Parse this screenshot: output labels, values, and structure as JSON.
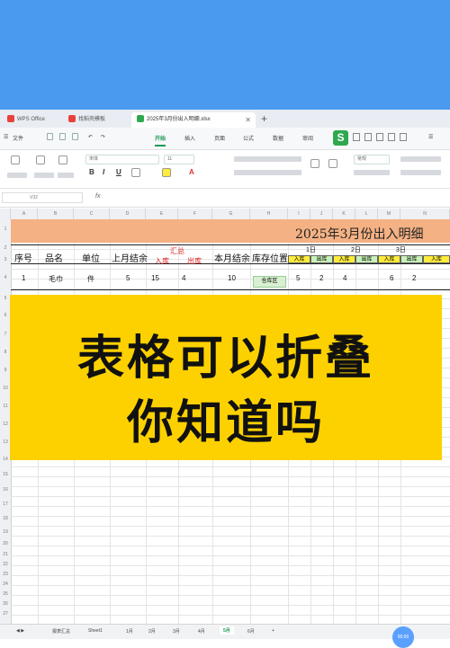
{
  "browser_tabs": [
    {
      "label": "WPS Office",
      "color": "#e8423b"
    },
    {
      "label": "找稻壳模板",
      "color": "#e8423b"
    },
    {
      "label": "2025年3月份出入明细.xlsx",
      "color": "#2fa84f"
    }
  ],
  "menu": {
    "file": "文件",
    "items": [
      "开始",
      "插入",
      "页面",
      "公式",
      "数据",
      "审阅"
    ],
    "selected": "开始"
  },
  "ribbon": {
    "font_name": "宋体",
    "font_size": "11",
    "format_buttons": [
      "B",
      "I",
      "U",
      "A"
    ],
    "number_format": "常规"
  },
  "formula_bar": {
    "cell_ref": "V32",
    "fx": "fx"
  },
  "columns": [
    "A",
    "B",
    "C",
    "D",
    "E",
    "F",
    "G",
    "H",
    "I",
    "J",
    "K",
    "L",
    "M",
    "N"
  ],
  "rows": [
    "1",
    "2",
    "3",
    "4",
    "5",
    "6",
    "7",
    "8",
    "9",
    "10",
    "11",
    "12",
    "13",
    "14",
    "15",
    "16",
    "17",
    "18",
    "19",
    "20",
    "21",
    "22",
    "23",
    "24",
    "25",
    "26",
    "27",
    "28",
    "29",
    "30",
    "31",
    "32",
    "33",
    "34",
    "35",
    "36",
    "37",
    "38",
    "39",
    "40",
    "41"
  ],
  "sheet": {
    "title": "2025年3月份出入明细",
    "headers": {
      "no": "序号",
      "name": "品名",
      "unit": "单位",
      "last_month": "上月结余",
      "summary": "汇总",
      "in": "入库",
      "out": "出库",
      "this_month": "本月结余",
      "location": "库存位置"
    },
    "day_groups": [
      "1日",
      "2日",
      "3日"
    ],
    "day_sub": [
      "入库",
      "出库"
    ],
    "row1": {
      "no": "1",
      "name": "毛巾",
      "unit": "件",
      "last_month": "5",
      "in": "15",
      "out": "4",
      "this_month": "10",
      "location": "仓库区",
      "d1_in": "5",
      "d1_out": "2",
      "d2_in": "4",
      "d3_in": "6",
      "d3_out": "2"
    }
  },
  "overlay": {
    "line1": "表格可以折叠",
    "line2": "你知道吗",
    "color": "#fdd100"
  },
  "sheet_tabs": [
    "报表汇总",
    "Sheet1",
    "1月",
    "2月",
    "3月",
    "4月",
    "5月",
    "6月"
  ],
  "active_sheet_tab": "5月",
  "fab_label": "00:00",
  "colors": {
    "top_band": "#4a9bf0",
    "title_band": "#f4b183",
    "accent": "#1f9a57"
  }
}
